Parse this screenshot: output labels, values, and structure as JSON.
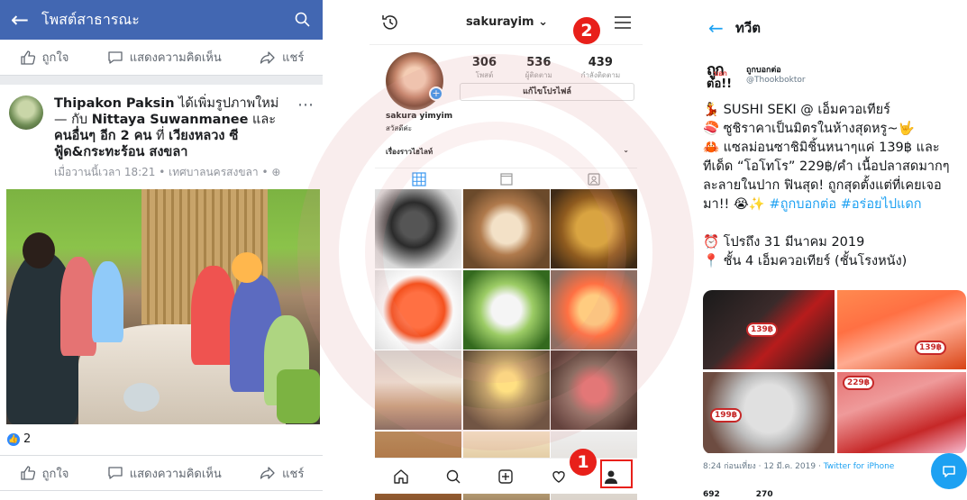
{
  "facebook": {
    "title": "โพสต์สาธารณะ",
    "actions": {
      "like": "ถูกใจ",
      "comment": "แสดงความคิดเห็น",
      "share": "แชร์"
    },
    "post": {
      "author": "Thipakon Paksin",
      "action_text": " ได้เพิ่มรูปภาพใหม่ — กับ ",
      "tagged_1": "Nittaya Suwanmanee",
      "tagged_and": " และ ",
      "tagged_others": "คนอื่นๆ อีก 2 คน",
      "at_text": " ที่ ",
      "place": "เวียงหลวง ซีฟู้ด&กระทะร้อน สงขลา",
      "time": "เมื่อวานนี้เวลา 18:21 • เทศบาลนครสงขลา • ⊕",
      "like_count": "2"
    }
  },
  "instagram": {
    "username": "sakurayim",
    "chevron": "⌄",
    "stats": [
      {
        "value": "306",
        "label": "โพสต์"
      },
      {
        "value": "536",
        "label": "ผู้ติดตาม"
      },
      {
        "value": "439",
        "label": "กำลังติดตาม"
      }
    ],
    "edit_profile": "แก้ไขโปรไฟล์",
    "display_name": "sakura yimyim",
    "bio": "สวัสดีค่ะ",
    "highlights_label": "เรื่องราวไฮไลท์",
    "highlights_chevron": "⌄",
    "badge_1": "1",
    "badge_2": "2"
  },
  "twitter": {
    "title": "ทวีต",
    "display_name": "ถูกบอกต่อ",
    "handle": "@Thookboktor",
    "logo_top": "ถูก",
    "logo_mid": "บอก",
    "logo_bot": "ต่อ!!",
    "line1": "💃 SUSHI SEKI @ เอ็มควอเทียร์",
    "line2": "🍣 ซูชิราคาเป็นมิตรในห้างสุดหรู~🤟",
    "line3": "🦀 แซลม่อนซาชิมิชิ้นหนาๆแค่ 139฿ และทีเด็ด “โอโทโร” 229฿/คำ เนื้อปลาสดมากๆละลายในปาก ฟินสุด! ถูกสุดตั้งแต่ที่เคยเจอมา!! 😭✨ ",
    "hashtag1": "#ถูกบอกต่อ",
    "hashtag2": "#อร่อยไปแดก",
    "promo": "⏰ โปรถึง 31 มีนาคม 2019",
    "location": "📍 ชั้น 4 เอ็มควอเทียร์ (ชั้นโรงหนัง)",
    "price_1": "139฿",
    "price_2": "229฿",
    "price_3": "199฿",
    "time_text": "8:24 ก่อนเที่ยง · 12 มี.ค. 2019 · ",
    "client": "Twitter for iPhone",
    "retweets": "692",
    "likes": "270"
  }
}
